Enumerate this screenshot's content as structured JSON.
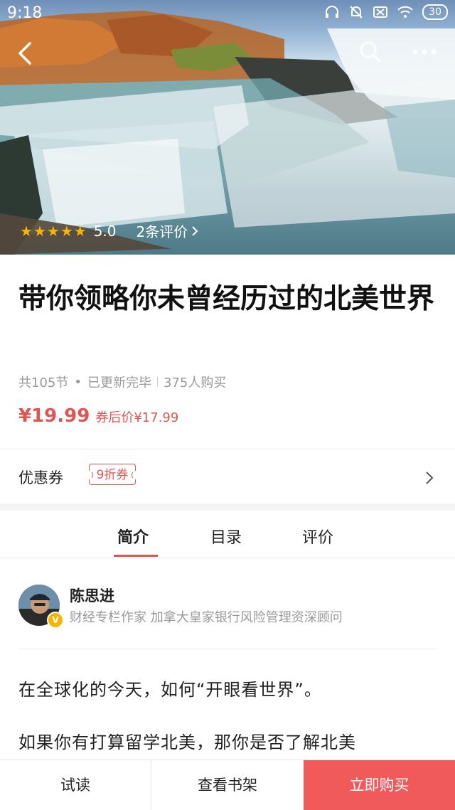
{
  "status_bar": {
    "time": "9:18",
    "battery": "30"
  },
  "hero": {
    "rating_value": "5.0",
    "reviews_link": "2条评价",
    "stars": 5
  },
  "book": {
    "title": "带你领略你未曾经历过的北美世界",
    "lessons": "共105节",
    "update_status": "已更新完毕",
    "buyers": "375人购买",
    "price": "¥19.99",
    "coupon_price": "券后价¥17.99"
  },
  "coupon": {
    "label": "优惠券",
    "tag": "9折券"
  },
  "tabs": [
    {
      "label": "简介",
      "active": true
    },
    {
      "label": "目录",
      "active": false
    },
    {
      "label": "评价",
      "active": false
    }
  ],
  "author": {
    "name": "陈思进",
    "description": "财经专栏作家 加拿大皇家银行风险管理资深顾问",
    "badge": "V"
  },
  "intro": [
    "在全球化的今天，如何“开眼看世界”。",
    "如果你有打算留学北美，那你是否了解北美"
  ],
  "bottom_bar": {
    "trial": "试读",
    "shelf": "查看书架",
    "buy": "立即购买"
  },
  "colors": {
    "accent": "#e05550",
    "buy_button": "#f05a5a",
    "star": "#f5b500"
  }
}
